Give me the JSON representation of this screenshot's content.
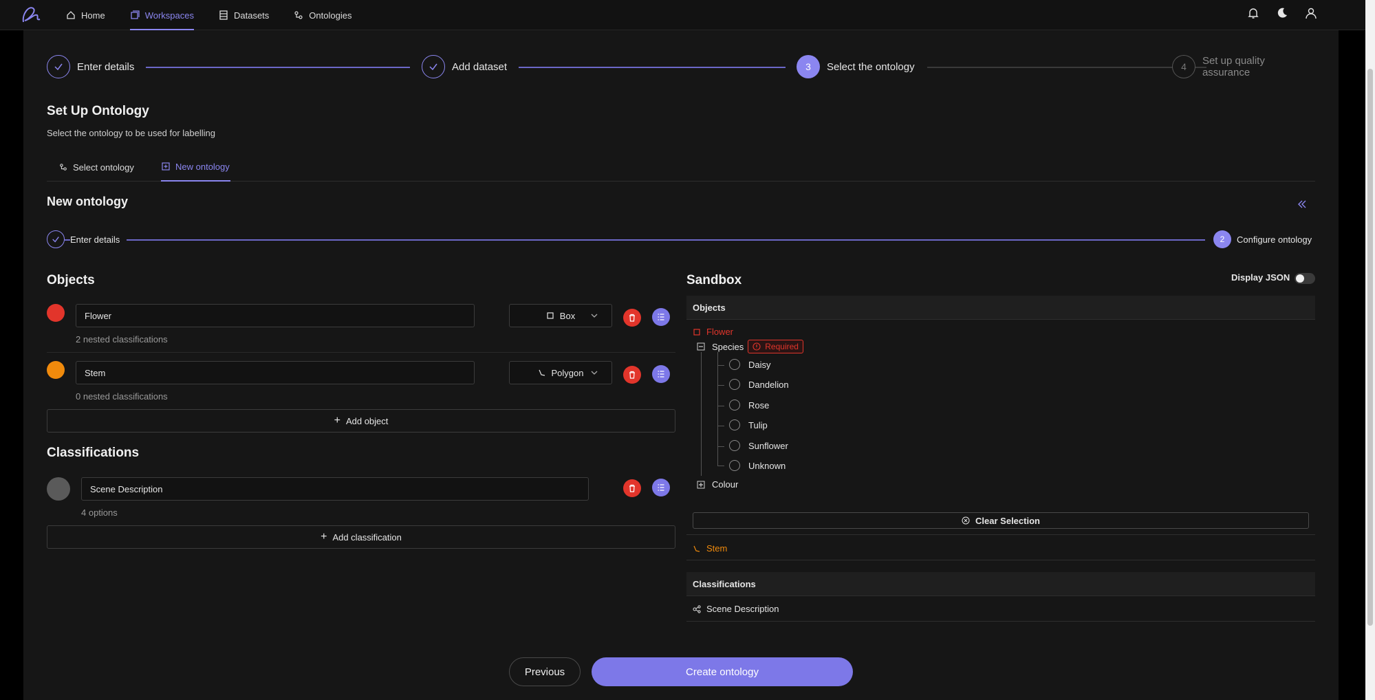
{
  "nav": {
    "items": [
      {
        "label": "Home",
        "icon": "home-icon"
      },
      {
        "label": "Workspaces",
        "icon": "workspace-icon"
      },
      {
        "label": "Datasets",
        "icon": "dataset-icon"
      },
      {
        "label": "Ontologies",
        "icon": "ontology-icon"
      }
    ],
    "active": "Workspaces"
  },
  "wizard": {
    "steps": [
      {
        "number": "1",
        "label": "Enter details",
        "state": "done"
      },
      {
        "number": "2",
        "label": "Add dataset",
        "state": "done"
      },
      {
        "number": "3",
        "label": "Select the ontology",
        "state": "current"
      },
      {
        "number": "4",
        "label": "Set up quality assurance",
        "state": "pending"
      }
    ]
  },
  "setup": {
    "title": "Set Up Ontology",
    "subtitle": "Select the ontology to be used for labelling",
    "tabs": [
      {
        "label": "Select ontology"
      },
      {
        "label": "New ontology"
      }
    ],
    "active_tab": "New ontology"
  },
  "new_ontology": {
    "title": "New ontology",
    "collapse_label": "«",
    "substeps": [
      {
        "number": "1",
        "label": "Enter details",
        "state": "done"
      },
      {
        "number": "2",
        "label": "Configure ontology",
        "state": "current"
      }
    ]
  },
  "objects": {
    "title": "Objects",
    "items": [
      {
        "name": "Flower",
        "color": "#e2352b",
        "shape": "Box",
        "nested": "2 nested classifications"
      },
      {
        "name": "Stem",
        "color": "#f08a0c",
        "shape": "Polygon",
        "nested": "0 nested classifications"
      }
    ],
    "add_label": "Add object"
  },
  "classifications": {
    "title": "Classifications",
    "items": [
      {
        "name": "Scene Description",
        "color": "#5a5a5a",
        "options": "4 options"
      }
    ],
    "add_label": "Add classification"
  },
  "sandbox": {
    "title": "Sandbox",
    "display_json_label": "Display JSON",
    "display_json": false,
    "objects_header": "Objects",
    "flower": "Flower",
    "species": "Species",
    "required": "Required",
    "options": [
      "Daisy",
      "Dandelion",
      "Rose",
      "Tulip",
      "Sunflower",
      "Unknown"
    ],
    "colour": "Colour",
    "clear_label": "Clear Selection",
    "stem": "Stem",
    "classifications_header": "Classifications",
    "scene_description": "Scene Description"
  },
  "footer": {
    "previous": "Previous",
    "create": "Create ontology"
  },
  "colors": {
    "accent": "#8b86f0",
    "danger": "#e2352b",
    "warning": "#f08a0c"
  }
}
